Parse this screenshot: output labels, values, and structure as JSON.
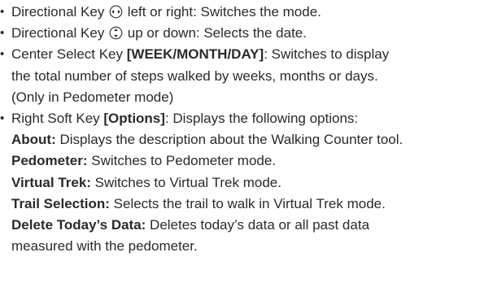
{
  "items": [
    {
      "lead": "Directional Key ",
      "icon": "left-right-navigation-key-icon",
      "rest": " left or right: Switches the mode."
    },
    {
      "lead": "Directional Key ",
      "icon": "up-down-navigation-key-icon",
      "rest": " up or down: Selects the date."
    },
    {
      "lead": "Center Select Key ",
      "key": "[WEEK/MONTH/DAY]",
      "rest": ": Switches to display",
      "lines": [
        "the total number of steps walked by weeks, months or days.",
        "(Only in Pedometer mode)"
      ]
    },
    {
      "lead": "Right Soft Key ",
      "key": "[Options]",
      "rest": ": Displays the following options:",
      "options": [
        {
          "term": "About:",
          "desc": " Displays the description about the Walking Counter tool."
        },
        {
          "term": "Pedometer:",
          "desc": " Switches to Pedometer mode."
        },
        {
          "term": "Virtual Trek:",
          "desc": " Switches to Virtual Trek mode."
        },
        {
          "term": "Trail Selection:",
          "desc": " Selects the trail to walk in Virtual Trek mode."
        },
        {
          "term": "Delete Today’s Data:",
          "desc": " Deletes today’s data or all past data"
        }
      ],
      "tail": "measured with the pedometer."
    }
  ],
  "bullet_char": "•"
}
